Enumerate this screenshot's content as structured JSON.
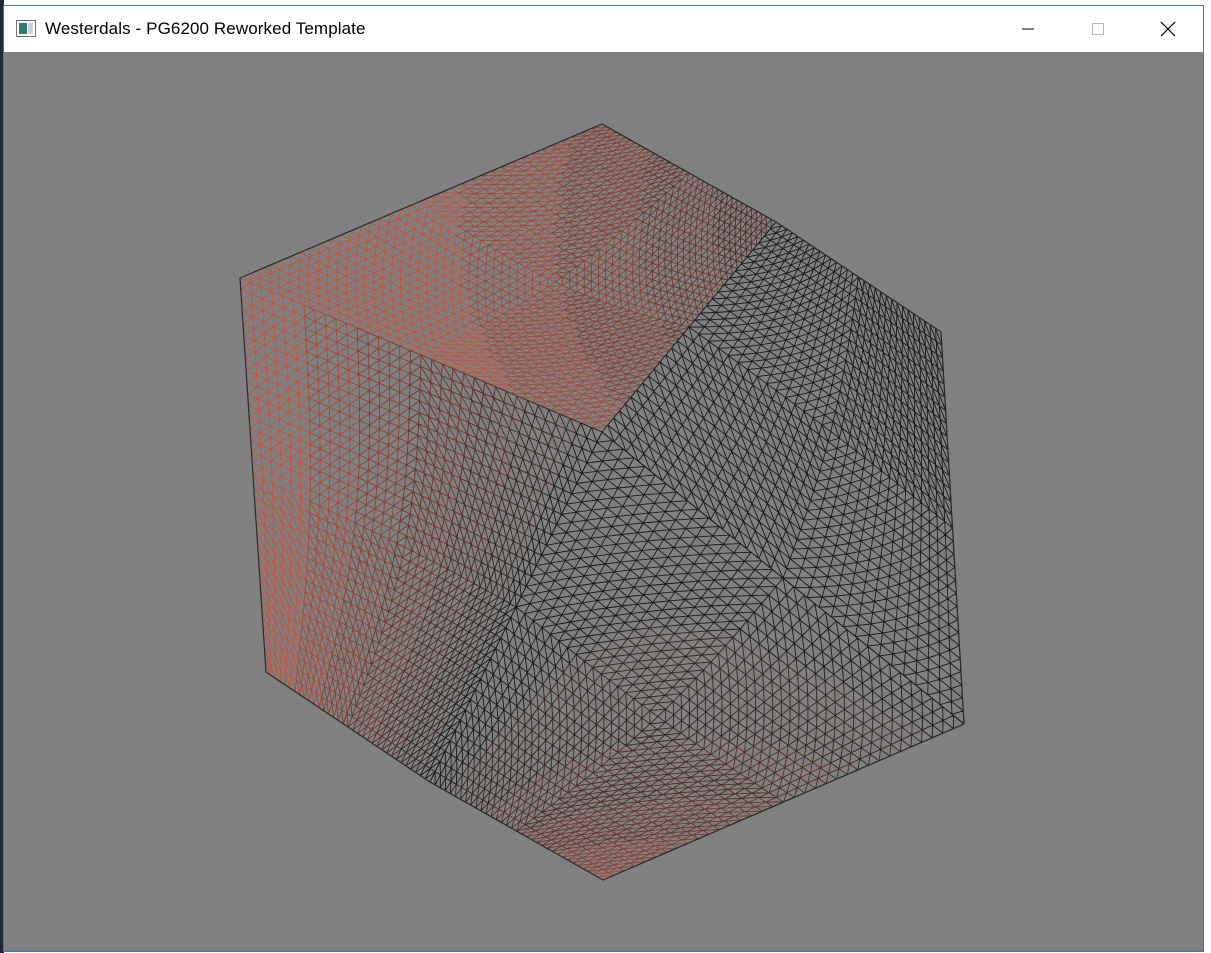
{
  "window": {
    "title": "Westerdals - PG6200 Reworked Template",
    "controls": {
      "minimize": "minimize-icon",
      "maximize": "maximize-icon",
      "close": "close-icon"
    }
  },
  "viewport": {
    "background": "#808080",
    "render_mode": "wireframe",
    "object": "cube",
    "colors": {
      "lit_wire": "#c2543f",
      "shadow_wire": "#1a1a1a"
    }
  }
}
